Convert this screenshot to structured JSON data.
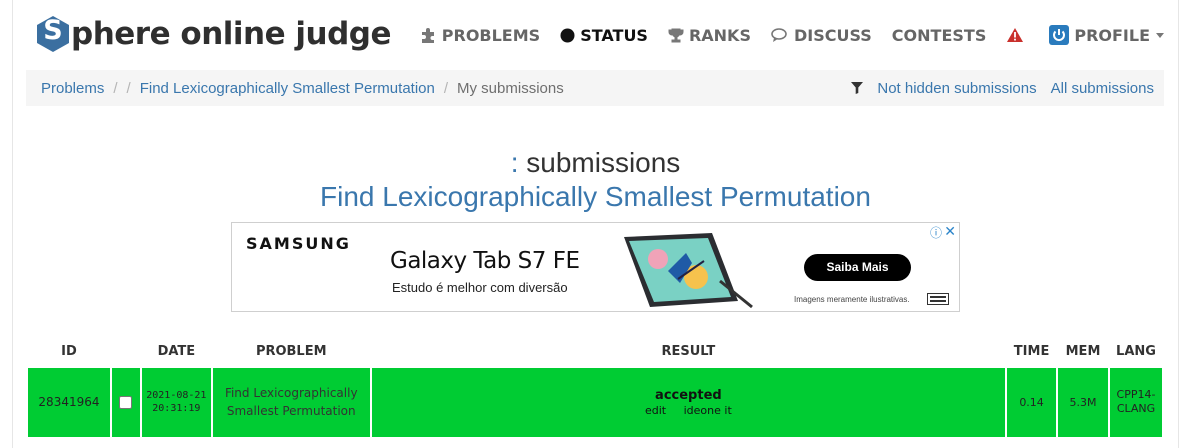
{
  "logo": {
    "letter": "S",
    "text": "phere online judge",
    "brand_color": "#3b6fa0"
  },
  "nav": [
    {
      "icon": "puzzle-icon",
      "label": "PROBLEMS"
    },
    {
      "icon": "status-dot-icon",
      "label": "STATUS"
    },
    {
      "icon": "trophy-icon",
      "label": "RANKS"
    },
    {
      "icon": "chat-icon",
      "label": "DISCUSS"
    },
    {
      "icon": "",
      "label": "CONTESTS"
    },
    {
      "icon": "warning-icon",
      "label": ""
    },
    {
      "icon": "power-icon",
      "label": "PROFILE"
    }
  ],
  "breadcrumb": {
    "items": [
      "Problems",
      "Find Lexicographically Smallest Permutation",
      "My submissions"
    ],
    "filter_links": [
      "Not hidden submissions",
      "All submissions"
    ]
  },
  "page": {
    "title_prefix": ":",
    "title": "submissions",
    "subtitle": "Find Lexicographically Smallest Permutation"
  },
  "ad": {
    "brand": "SAMSUNG",
    "product": "Galaxy Tab S7 FE",
    "tagline": "Estudo é melhor com diversão",
    "cta": "Saiba Mais",
    "disclaimer": "Imagens meramente ilustrativas."
  },
  "table": {
    "headers": [
      "ID",
      "",
      "DATE",
      "PROBLEM",
      "RESULT",
      "TIME",
      "MEM",
      "LANG"
    ],
    "rows": [
      {
        "id": "28341964",
        "date": "2021-08-21",
        "time_of_day": "20:31:19",
        "problem": "Find Lexicographically Smallest Permutation",
        "result": "accepted",
        "actions": [
          "edit",
          "ideone it"
        ],
        "time": "0.14",
        "mem": "5.3M",
        "lang": "CPP14-CLANG",
        "status_color": "#00cc33"
      }
    ]
  }
}
